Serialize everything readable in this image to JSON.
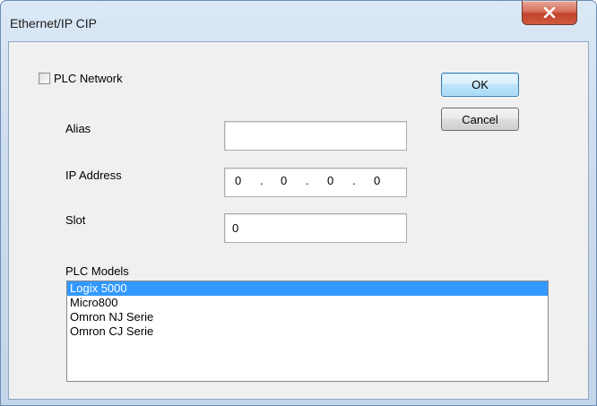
{
  "window": {
    "title": "Ethernet/IP CIP"
  },
  "plc_network": {
    "label": "PLC Network",
    "checked": false
  },
  "fields": {
    "alias_label": "Alias",
    "alias_value": "",
    "ip_label": "IP Address",
    "ip_octets": [
      "0",
      "0",
      "0",
      "0"
    ],
    "ip_separator": ".",
    "slot_label": "Slot",
    "slot_value": "0"
  },
  "buttons": {
    "ok": "OK",
    "cancel": "Cancel"
  },
  "models": {
    "label": "PLC Models",
    "items": [
      "Logix 5000",
      "Micro800",
      "Omron NJ Serie",
      "Omron CJ Serie"
    ],
    "selected_index": 0
  },
  "colors": {
    "selection": "#3399ff",
    "close_button": "#c3432d"
  },
  "icons": {
    "close": "close-x-icon"
  }
}
